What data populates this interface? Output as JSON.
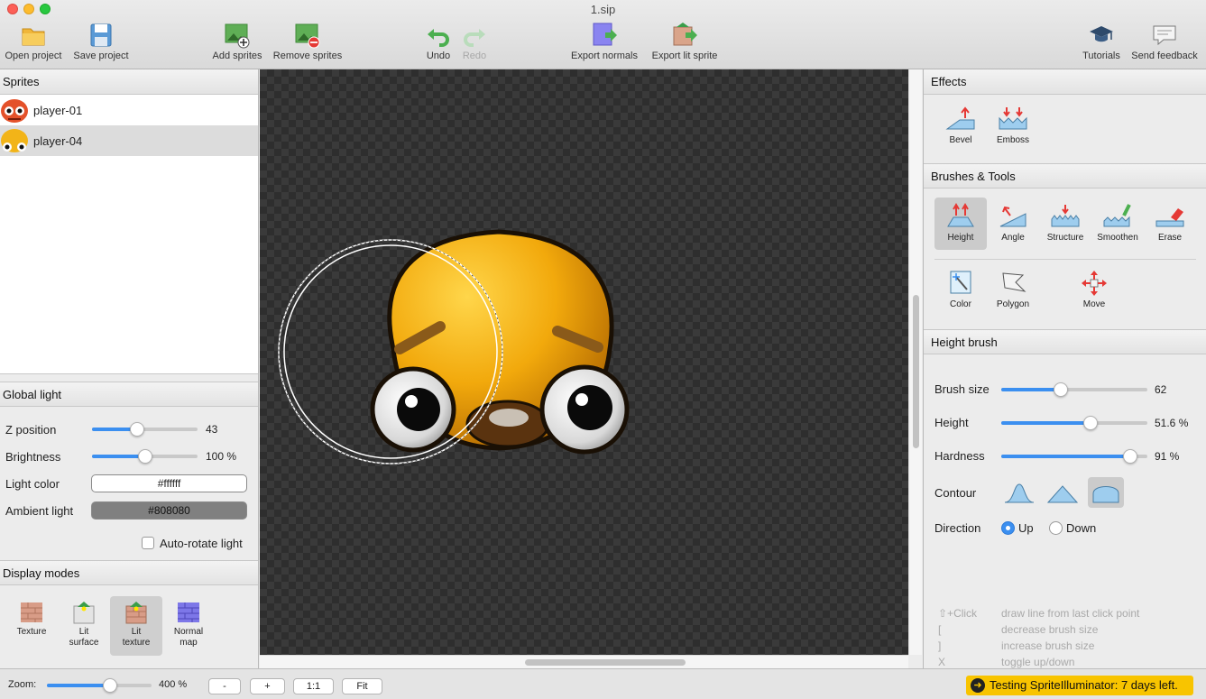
{
  "window": {
    "title": "1.sip"
  },
  "toolbar": {
    "open_project": "Open project",
    "save_project": "Save project",
    "add_sprites": "Add sprites",
    "remove_sprites": "Remove sprites",
    "undo": "Undo",
    "redo": "Redo",
    "export_normals": "Export normals",
    "export_lit_sprite": "Export lit sprite",
    "tutorials": "Tutorials",
    "send_feedback": "Send feedback"
  },
  "sprites": {
    "header": "Sprites",
    "items": [
      {
        "name": "player-01",
        "selected": false
      },
      {
        "name": "player-04",
        "selected": true
      }
    ]
  },
  "global_light": {
    "header": "Global light",
    "z_position": {
      "label": "Z position",
      "value": "43",
      "fraction": 0.43
    },
    "brightness": {
      "label": "Brightness",
      "value": "100 %",
      "fraction": 0.5
    },
    "light_color": {
      "label": "Light color",
      "value": "#ffffff"
    },
    "ambient_light": {
      "label": "Ambient light",
      "value": "#808080"
    },
    "auto_rotate": {
      "label": "Auto-rotate light",
      "checked": false
    }
  },
  "display_modes": {
    "header": "Display modes",
    "items": [
      {
        "label": "Texture",
        "selected": false
      },
      {
        "label": "Lit\nsurface",
        "selected": false
      },
      {
        "label": "Lit\ntexture",
        "selected": true
      },
      {
        "label": "Normal\nmap",
        "selected": false
      }
    ]
  },
  "effects": {
    "header": "Effects",
    "bevel": "Bevel",
    "emboss": "Emboss"
  },
  "brushes_tools": {
    "header": "Brushes & Tools",
    "height": "Height",
    "angle": "Angle",
    "structure": "Structure",
    "smoothen": "Smoothen",
    "erase": "Erase",
    "color": "Color",
    "polygon": "Polygon",
    "move": "Move",
    "selected": "Height"
  },
  "height_brush": {
    "header": "Height brush",
    "brush_size": {
      "label": "Brush size",
      "value": "62",
      "fraction": 0.41
    },
    "height": {
      "label": "Height",
      "value": "51.6 %",
      "fraction": 0.61
    },
    "hardness": {
      "label": "Hardness",
      "value": "91 %",
      "fraction": 0.88
    },
    "contour_label": "Contour",
    "contour_selected": 2,
    "direction_label": "Direction",
    "direction_up": "Up",
    "direction_down": "Down",
    "direction_value": "Up"
  },
  "hints": [
    {
      "key": "⇧+Click",
      "desc": "draw line from last click point"
    },
    {
      "key": "[",
      "desc": "decrease brush size"
    },
    {
      "key": "]",
      "desc": "increase brush size"
    },
    {
      "key": "X",
      "desc": "toggle up/down"
    }
  ],
  "bottom": {
    "zoom_label": "Zoom:",
    "zoom_value": "400 %",
    "zoom_fraction": 0.6,
    "minus": "-",
    "plus": "+",
    "one_to_one": "1:1",
    "fit": "Fit",
    "trial": "Testing SpriteIlluminator: 7 days left."
  },
  "colors": {
    "accent": "#3b8ff0",
    "trial_bg": "#f8c400",
    "canvas_dark": "#2e2e2e",
    "canvas_light": "#3a3a3a"
  }
}
